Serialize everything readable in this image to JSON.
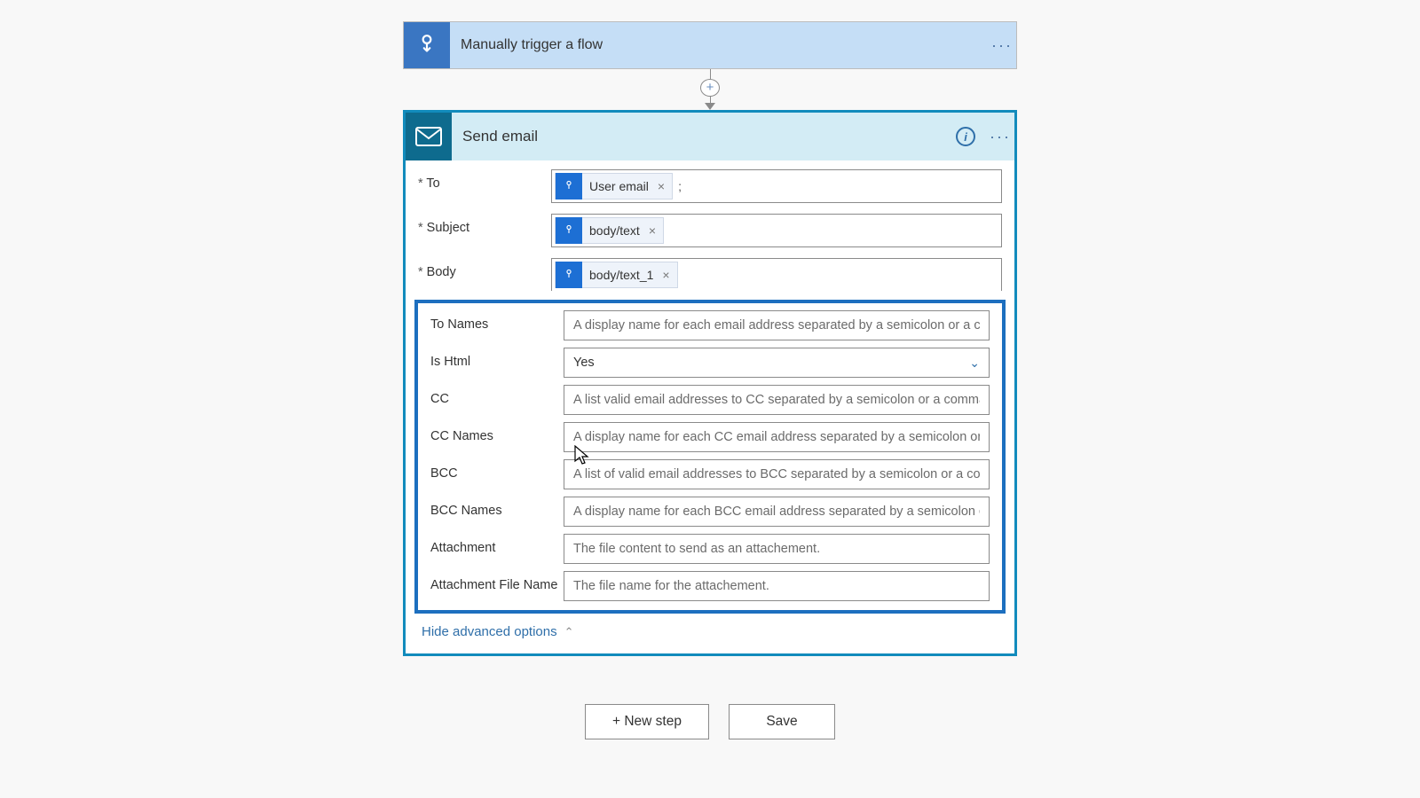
{
  "trigger": {
    "title": "Manually trigger a flow"
  },
  "action": {
    "title": "Send email",
    "fields": {
      "to": {
        "label": "To",
        "required": true,
        "tokens": [
          "User email"
        ],
        "suffix": ";"
      },
      "subject": {
        "label": "Subject",
        "required": true,
        "tokens": [
          "body/text"
        ]
      },
      "body": {
        "label": "Body",
        "required": true,
        "tokens": [
          "body/text_1"
        ]
      }
    },
    "advanced": {
      "toNames": {
        "label": "To Names",
        "placeholder": "A display name for each email address separated by a semicolon or a comma."
      },
      "isHtml": {
        "label": "Is Html",
        "value": "Yes"
      },
      "cc": {
        "label": "CC",
        "placeholder": "A list valid email addresses to CC separated by a semicolon or a comma."
      },
      "ccNames": {
        "label": "CC Names",
        "placeholder": "A display name for each CC email address separated by a semicolon or a comma."
      },
      "bcc": {
        "label": "BCC",
        "placeholder": "A list of valid email addresses to BCC separated by a semicolon or a comma."
      },
      "bccNames": {
        "label": "BCC Names",
        "placeholder": "A display name for each BCC email address separated by a semicolon or a comma."
      },
      "attachment": {
        "label": "Attachment",
        "placeholder": "The file content to send as an attachement."
      },
      "attachFile": {
        "label": "Attachment File Name",
        "placeholder": "The file name for the attachement."
      }
    },
    "hideAdvanced": "Hide advanced options"
  },
  "buttons": {
    "newStep": "+ New step",
    "save": "Save"
  }
}
